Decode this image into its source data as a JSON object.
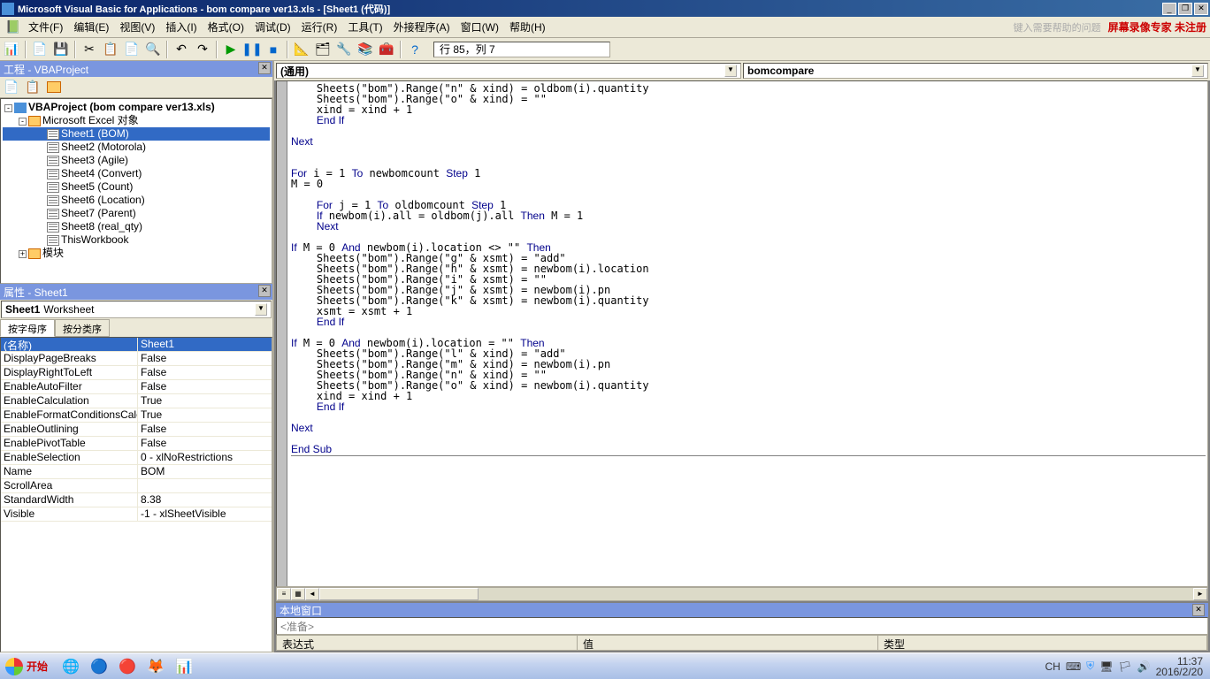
{
  "titlebar": {
    "text": "Microsoft Visual Basic for Applications - bom compare ver13.xls - [Sheet1 (代码)]"
  },
  "menu": {
    "file": "文件(F)",
    "edit": "编辑(E)",
    "view": "视图(V)",
    "insert": "插入(I)",
    "format": "格式(O)",
    "debug": "调试(D)",
    "run": "运行(R)",
    "tools": "工具(T)",
    "addins": "外接程序(A)",
    "window": "窗口(W)",
    "help": "帮助(H)",
    "hint": "键入需要帮助的问题",
    "watermark": "屏幕录像专家 未注册"
  },
  "toolbar_status": "行 85，列 7",
  "project_panel": {
    "title": "工程 - VBAProject",
    "root": "VBAProject (bom compare ver13.xls)",
    "folder1": "Microsoft Excel 对象",
    "items": [
      "Sheet1 (BOM)",
      "Sheet2 (Motorola)",
      "Sheet3 (Agile)",
      "Sheet4 (Convert)",
      "Sheet5 (Count)",
      "Sheet6 (Location)",
      "Sheet7 (Parent)",
      "Sheet8 (real_qty)",
      "ThisWorkbook"
    ],
    "folder2": "模块"
  },
  "props_panel": {
    "title": "属性 - Sheet1",
    "obj_name": "Sheet1",
    "obj_type": "Worksheet",
    "tab_alpha": "按字母序",
    "tab_cat": "按分类序",
    "rows": [
      {
        "n": "(名称)",
        "v": "Sheet1",
        "sel": true
      },
      {
        "n": "DisplayPageBreaks",
        "v": "False"
      },
      {
        "n": "DisplayRightToLeft",
        "v": "False"
      },
      {
        "n": "EnableAutoFilter",
        "v": "False"
      },
      {
        "n": "EnableCalculation",
        "v": "True"
      },
      {
        "n": "EnableFormatConditionsCalculation",
        "v": "True"
      },
      {
        "n": "EnableOutlining",
        "v": "False"
      },
      {
        "n": "EnablePivotTable",
        "v": "False"
      },
      {
        "n": "EnableSelection",
        "v": "0 - xlNoRestrictions"
      },
      {
        "n": "Name",
        "v": "BOM"
      },
      {
        "n": "ScrollArea",
        "v": ""
      },
      {
        "n": "StandardWidth",
        "v": "8.38"
      },
      {
        "n": "Visible",
        "v": "-1 - xlSheetVisible"
      }
    ]
  },
  "code": {
    "combo_left": "(通用)",
    "combo_right": "bomcompare"
  },
  "watch": {
    "title": "本地窗口",
    "ready": "<准备>",
    "col1": "表达式",
    "col2": "值",
    "col3": "类型"
  },
  "taskbar": {
    "start": "开始",
    "ime": "CH",
    "time": "11:37",
    "date": "2016/2/20"
  }
}
